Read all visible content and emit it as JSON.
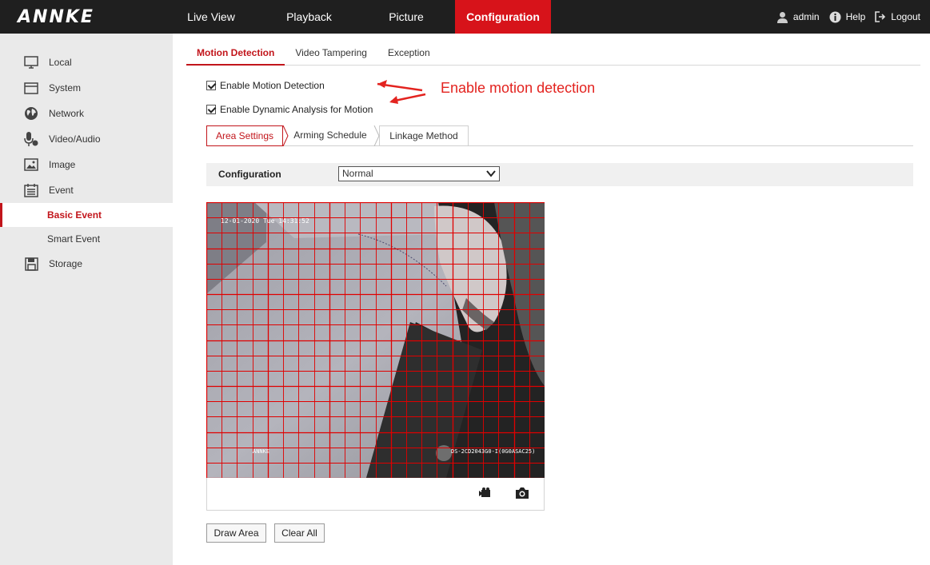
{
  "brand": {
    "logo_text": "ANNKE"
  },
  "topnav": {
    "items": [
      "Live View",
      "Playback",
      "Picture",
      "Configuration"
    ],
    "active": "Configuration",
    "user": "admin",
    "help": "Help",
    "logout": "Logout"
  },
  "sidebar": {
    "items": [
      "Local",
      "System",
      "Network",
      "Video/Audio",
      "Image",
      "Event"
    ],
    "event_sub": [
      "Basic Event",
      "Smart Event"
    ],
    "active_sub": "Basic Event",
    "storage": "Storage"
  },
  "tabs": [
    "Motion Detection",
    "Video Tampering",
    "Exception"
  ],
  "active_tab": "Motion Detection",
  "checkboxes": {
    "motion_label": "Enable Motion Detection",
    "motion_checked": true,
    "dynamic_label": "Enable Dynamic Analysis for Motion",
    "dynamic_checked": true
  },
  "annotation": {
    "text": "Enable motion detection",
    "color": "#e3231f"
  },
  "subtabs": [
    "Area Settings",
    "Arming Schedule",
    "Linkage Method"
  ],
  "active_subtab": "Area Settings",
  "configuration": {
    "label": "Configuration",
    "value": "Normal"
  },
  "video": {
    "osd_datetime": "12-01-2020 Tue 14:31:52",
    "osd_brand": "ANNKE",
    "osd_model": "DS-2CD2043G0-I(0G0ASAC25)",
    "grid_color": "#e00000"
  },
  "buttons": {
    "draw_area": "Draw Area",
    "clear_all": "Clear All"
  },
  "colors": {
    "accent": "#d7131a",
    "topbar": "#1f1f1f",
    "sidebar": "#eaeaea"
  }
}
